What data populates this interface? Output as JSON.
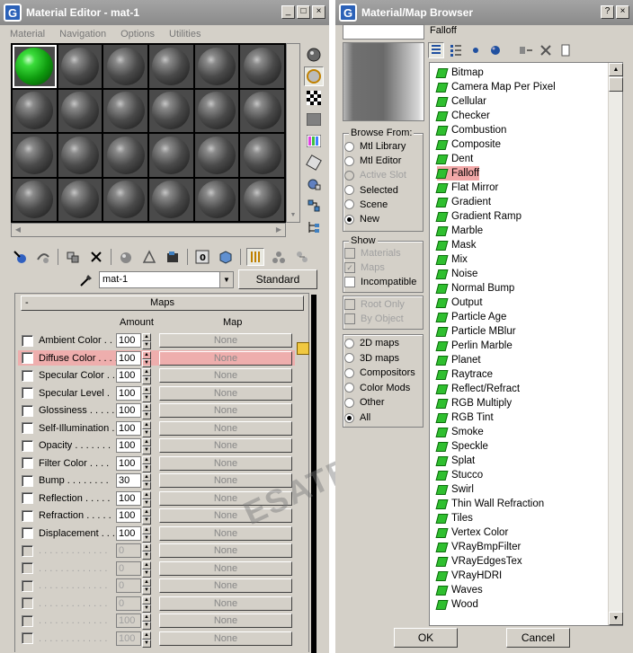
{
  "material_editor": {
    "title": "Material Editor - mat-1",
    "window_buttons": [
      "_",
      "□",
      "×"
    ],
    "menu": [
      "Material",
      "Navigation",
      "Options",
      "Utilities"
    ],
    "material_name": "mat-1",
    "type_button": "Standard",
    "rollout_title": "Maps",
    "rollout_toggle": "-",
    "col_amount": "Amount",
    "col_map": "Map",
    "maps": [
      {
        "label": "Ambient Color . . .",
        "amount": "100",
        "map": "None",
        "enabled": true
      },
      {
        "label": "Diffuse Color . . . .",
        "amount": "100",
        "map": "None",
        "enabled": true
      },
      {
        "label": "Specular Color . .",
        "amount": "100",
        "map": "None",
        "enabled": true
      },
      {
        "label": "Specular Level .",
        "amount": "100",
        "map": "None",
        "enabled": true
      },
      {
        "label": "Glossiness . . . . .",
        "amount": "100",
        "map": "None",
        "enabled": true
      },
      {
        "label": "Self-Illumination .",
        "amount": "100",
        "map": "None",
        "enabled": true
      },
      {
        "label": "Opacity . . . . . . .",
        "amount": "100",
        "map": "None",
        "enabled": true
      },
      {
        "label": "Filter Color . . . .",
        "amount": "100",
        "map": "None",
        "enabled": true
      },
      {
        "label": "Bump . . . . . . . .",
        "amount": "30",
        "map": "None",
        "enabled": true
      },
      {
        "label": "Reflection . . . . .",
        "amount": "100",
        "map": "None",
        "enabled": true
      },
      {
        "label": "Refraction . . . . .",
        "amount": "100",
        "map": "None",
        "enabled": true
      },
      {
        "label": "Displacement . . .",
        "amount": "100",
        "map": "None",
        "enabled": true
      },
      {
        "label": ". . . . . . . . . . . . .",
        "amount": "0",
        "map": "None",
        "enabled": false
      },
      {
        "label": ". . . . . . . . . . . . .",
        "amount": "0",
        "map": "None",
        "enabled": false
      },
      {
        "label": ". . . . . . . . . . . . .",
        "amount": "0",
        "map": "None",
        "enabled": false
      },
      {
        "label": ". . . . . . . . . . . . .",
        "amount": "0",
        "map": "None",
        "enabled": false
      },
      {
        "label": ". . . . . . . . . . . . .",
        "amount": "100",
        "map": "None",
        "enabled": false
      },
      {
        "label": ". . . . . . . . . . . . .",
        "amount": "100",
        "map": "None",
        "enabled": false
      }
    ]
  },
  "browser": {
    "title": "Material/Map Browser",
    "window_buttons": [
      "?",
      "×"
    ],
    "selected_type": "Falloff",
    "browse_from_title": "Browse From:",
    "browse_from": [
      {
        "label": "Mtl Library",
        "state": "off"
      },
      {
        "label": "Mtl Editor",
        "state": "off"
      },
      {
        "label": "Active Slot",
        "state": "disabled"
      },
      {
        "label": "Selected",
        "state": "off"
      },
      {
        "label": "Scene",
        "state": "off"
      },
      {
        "label": "New",
        "state": "on"
      }
    ],
    "show_title": "Show",
    "show": [
      {
        "label": "Materials",
        "state": "disabled"
      },
      {
        "label": "Maps",
        "state": "checked-disabled"
      },
      {
        "label": "Incompatible",
        "state": "off"
      }
    ],
    "options": [
      {
        "label": "Root Only",
        "state": "disabled"
      },
      {
        "label": "By Object",
        "state": "disabled"
      }
    ],
    "filters": [
      {
        "label": "2D maps",
        "state": "off"
      },
      {
        "label": "3D maps",
        "state": "off"
      },
      {
        "label": "Compositors",
        "state": "off"
      },
      {
        "label": "Color Mods",
        "state": "off"
      },
      {
        "label": "Other",
        "state": "off"
      },
      {
        "label": "All",
        "state": "on"
      }
    ],
    "maps": [
      "Bitmap",
      "Camera Map Per Pixel",
      "Cellular",
      "Checker",
      "Combustion",
      "Composite",
      "Dent",
      "Falloff",
      "Flat Mirror",
      "Gradient",
      "Gradient Ramp",
      "Marble",
      "Mask",
      "Mix",
      "Noise",
      "Normal Bump",
      "Output",
      "Particle Age",
      "Particle MBlur",
      "Perlin Marble",
      "Planet",
      "Raytrace",
      "Reflect/Refract",
      "RGB Multiply",
      "RGB Tint",
      "Smoke",
      "Speckle",
      "Splat",
      "Stucco",
      "Swirl",
      "Thin Wall Refraction",
      "Tiles",
      "Vertex Color",
      "VRayBmpFilter",
      "VRayEdgesTex",
      "VRayHDRI",
      "Waves",
      "Wood"
    ],
    "highlighted_map": "Falloff",
    "ok_label": "OK",
    "cancel_label": "Cancel"
  },
  "watermark": "ESATE.ru",
  "colors": {
    "highlight": "#f2a8a8",
    "title_bar": "#8a8a8a",
    "window_bg": "#d4d0c8",
    "map_icon": "#2fbf2f"
  }
}
